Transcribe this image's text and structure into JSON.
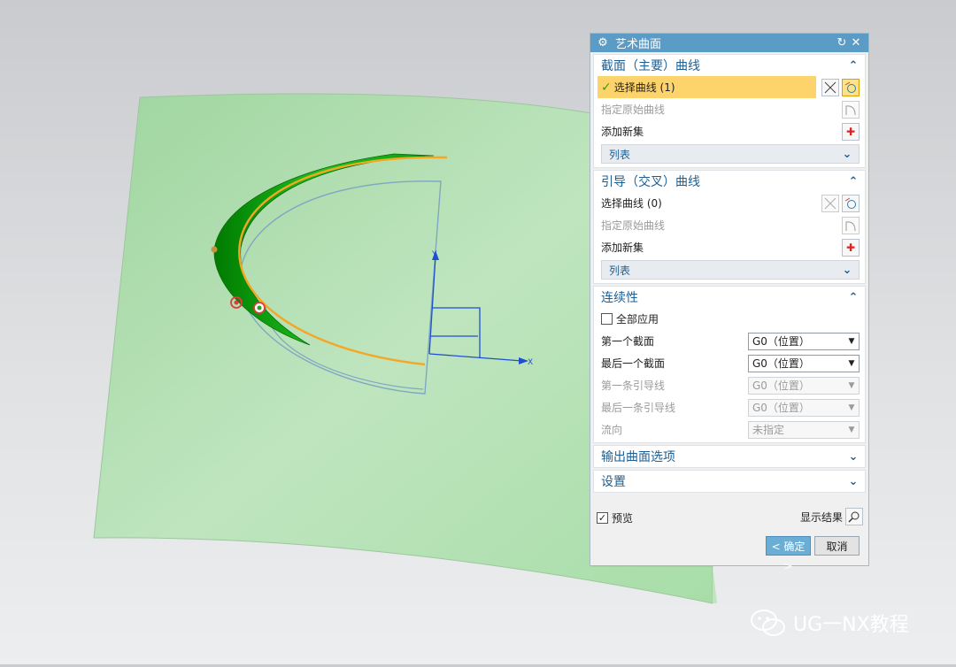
{
  "dialog": {
    "title": "艺术曲面",
    "icons": {
      "settings": "gear-icon",
      "reset": "reset-icon",
      "close": "close-icon"
    },
    "section_primary": {
      "title": "截面（主要）曲线",
      "select_curve": "选择曲线 (1)",
      "specify_origin": "指定原始曲线",
      "add_new_set": "添加新集",
      "list": "列表"
    },
    "section_cross": {
      "title": "引导（交叉）曲线",
      "select_curve": "选择曲线 (0)",
      "specify_origin": "指定原始曲线",
      "add_new_set": "添加新集",
      "list": "列表"
    },
    "section_continuity": {
      "title": "连续性",
      "apply_all": "全部应用",
      "apply_all_checked": false,
      "rows": [
        {
          "label": "第一个截面",
          "value": "G0（位置）",
          "enabled": true
        },
        {
          "label": "最后一个截面",
          "value": "G0（位置）",
          "enabled": true
        },
        {
          "label": "第一条引导线",
          "value": "G0（位置）",
          "enabled": false
        },
        {
          "label": "最后一条引导线",
          "value": "G0（位置）",
          "enabled": false
        },
        {
          "label": "流向",
          "value": "未指定",
          "enabled": false
        }
      ]
    },
    "section_output": {
      "title": "输出曲面选项"
    },
    "section_settings": {
      "title": "设置"
    },
    "preview": {
      "label": "预览",
      "checked": true
    },
    "show_result": "显示结果",
    "ok_button": "< 确定 >",
    "cancel_button": "取消"
  },
  "viewport": {
    "axis_x_label": "X",
    "axis_y_label": "Y"
  },
  "watermark": {
    "text": "UG一NX教程"
  },
  "colors": {
    "title_bar": "#5b9cc7",
    "section_title": "#1d5f93",
    "selection_highlight": "#fdd36b",
    "surface": "#b5e2b5",
    "curve": "#f5a623",
    "green_face": "#16a516"
  }
}
